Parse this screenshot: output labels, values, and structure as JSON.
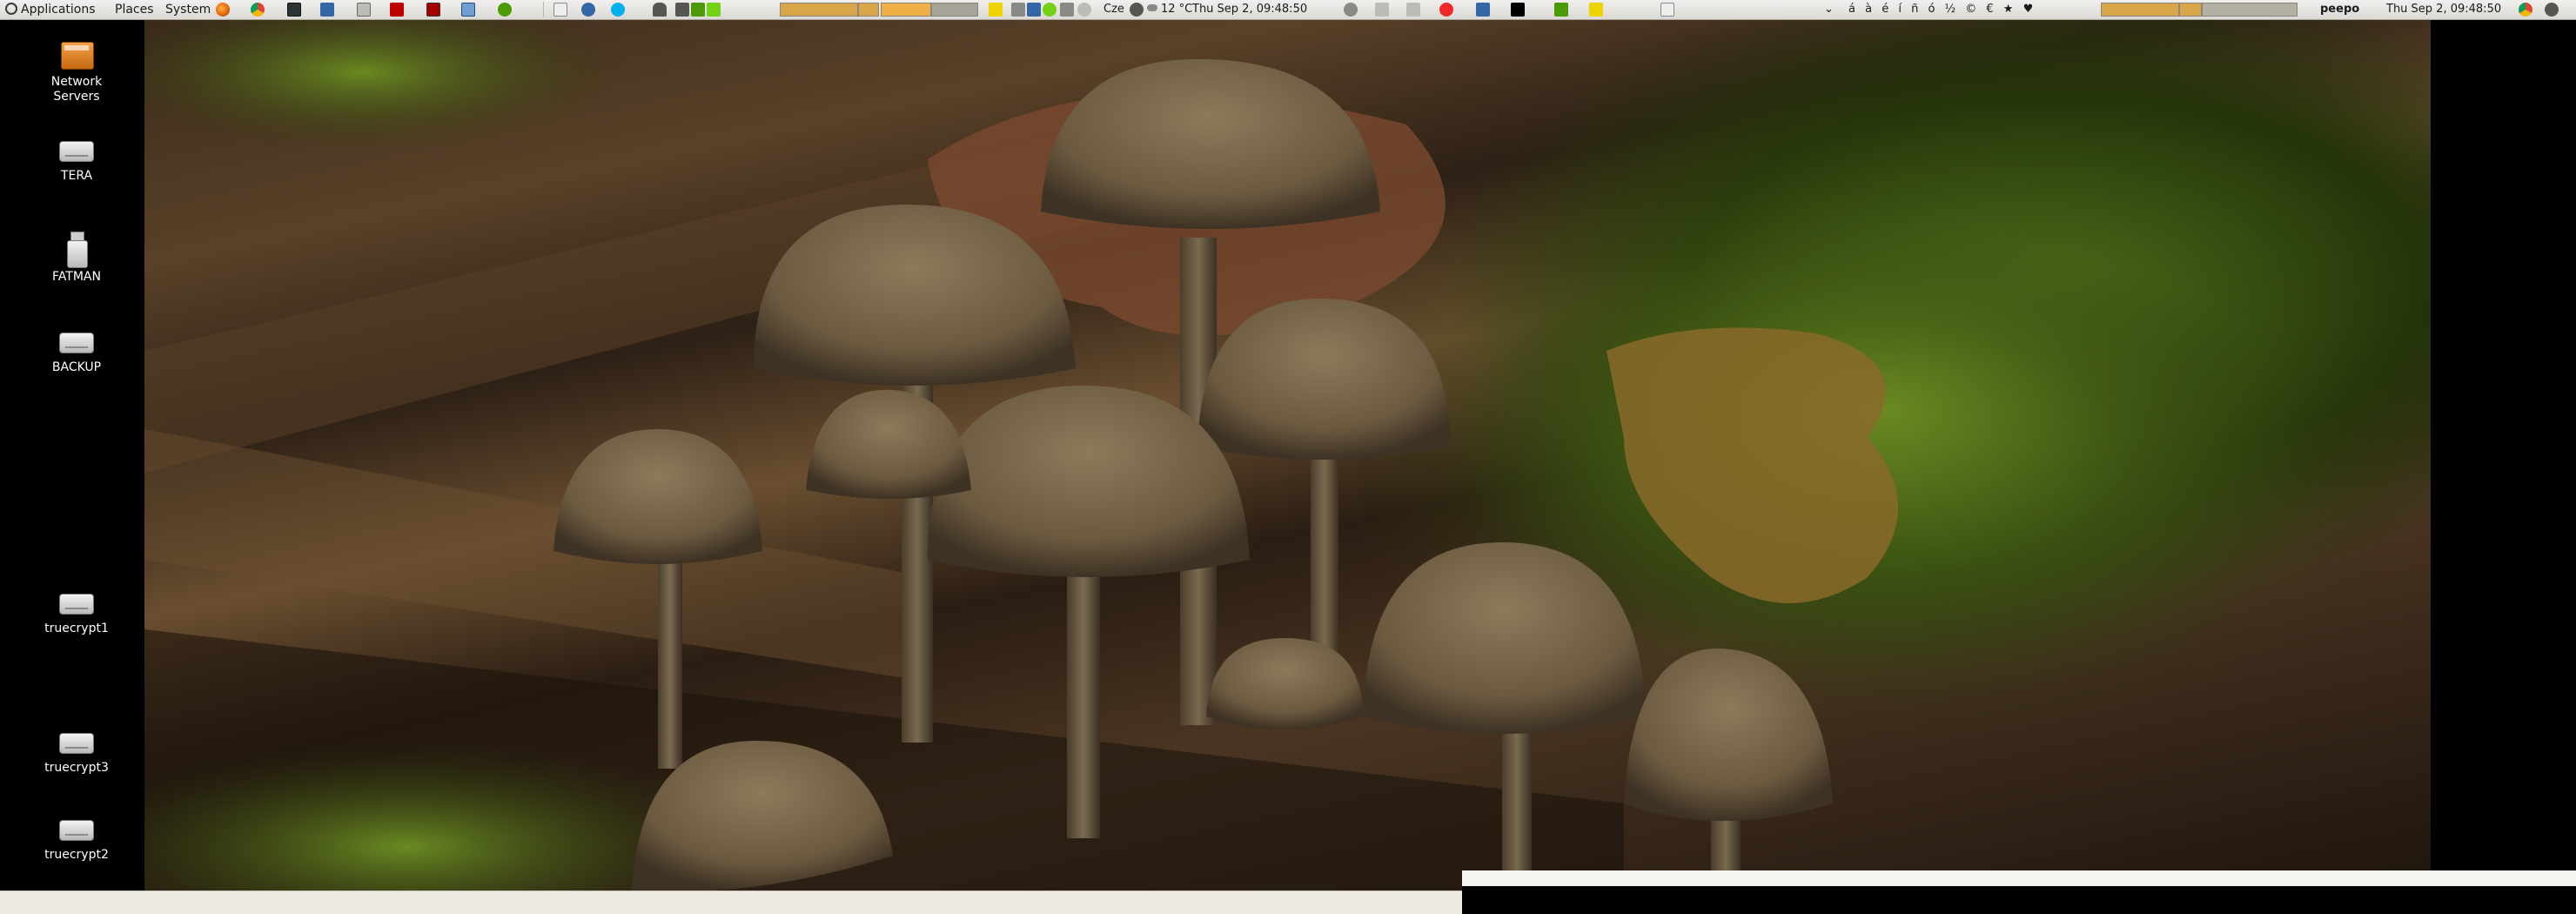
{
  "top_panel": {
    "menus": [
      "Applications",
      "Places",
      "System"
    ],
    "launchers": [
      {
        "name": "firefox-icon",
        "color": "#e66000"
      },
      {
        "name": "chrome-icon",
        "color": "#4285f4"
      },
      {
        "name": "terminal-icon",
        "color": "#2e3436"
      },
      {
        "name": "info-icon",
        "color": "#3465a4"
      },
      {
        "name": "settings-icon",
        "color": "#888a85"
      },
      {
        "name": "filezilla-icon",
        "color": "#bf0000"
      },
      {
        "name": "record-icon",
        "color": "#a40000"
      },
      {
        "name": "image-viewer-icon",
        "color": "#729fcf"
      },
      {
        "name": "network-icon",
        "color": "#4e9a06"
      },
      {
        "name": "text-editor-icon",
        "color": "#babdb6"
      },
      {
        "name": "chat-icon",
        "color": "#3465a4"
      },
      {
        "name": "skype-icon",
        "color": "#00aff0"
      },
      {
        "name": "shape-icon",
        "color": "#555753"
      },
      {
        "name": "package-icon",
        "color": "#73d216"
      }
    ],
    "weather": "12 °C",
    "clock": "Thu Sep  2, 09:48:50",
    "keyboard_layout": "Cze",
    "special_chars": "á à é í ñ ó ½ © € ★ ♥",
    "username": "peepo",
    "clock_right": "Thu Sep  2, 09:48:50"
  },
  "desktop_icons": [
    {
      "label_lines": [
        "Network",
        "Servers"
      ],
      "icon": "network-servers-icon"
    },
    {
      "label_lines": [
        "TERA"
      ],
      "icon": "drive-icon"
    },
    {
      "label_lines": [
        "FATMAN"
      ],
      "icon": "usb-drive-icon"
    },
    {
      "label_lines": [
        "BACKUP"
      ],
      "icon": "drive-icon"
    },
    {
      "label_lines": [
        "truecrypt1"
      ],
      "icon": "drive-icon"
    },
    {
      "label_lines": [
        "truecrypt3"
      ],
      "icon": "drive-icon"
    },
    {
      "label_lines": [
        "truecrypt2"
      ],
      "icon": "drive-icon"
    }
  ],
  "wallpaper": {
    "subject": "mushrooms-on-mossy-log"
  }
}
